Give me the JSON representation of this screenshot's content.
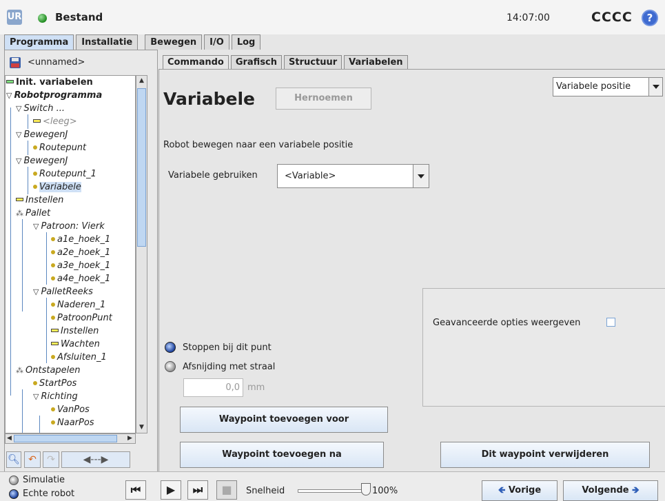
{
  "header": {
    "logo": "UR",
    "title": "Bestand",
    "time": "14:07:00",
    "robot_name": "CCCC",
    "help": "?"
  },
  "main_tabs": [
    {
      "label": "Programma",
      "active": true
    },
    {
      "label": "Installatie",
      "active": false
    },
    {
      "label": "Bewegen",
      "active": false
    },
    {
      "label": "I/O",
      "active": false
    },
    {
      "label": "Log",
      "active": false
    }
  ],
  "program": {
    "name": "<unnamed>",
    "tree": [
      "Init. variabelen",
      "Robotprogramma",
      "Switch ...",
      "<leeg>",
      "BewegenJ",
      "Routepunt",
      "BewegenJ",
      "Routepunt_1",
      "Variabele",
      "Instellen",
      "Pallet",
      "Patroon: Vierk",
      "a1e_hoek_1",
      "a2e_hoek_1",
      "a3e_hoek_1",
      "a4e_hoek_1",
      "PalletReeks",
      "Naderen_1",
      "PatroonPunt",
      "Instellen",
      "Wachten",
      "Afsluiten_1",
      "Ontstapelen",
      "StartPos",
      "Richting",
      "VanPos",
      "NaarPos"
    ],
    "selected": "Variabele"
  },
  "sub_tabs": [
    {
      "label": "Commando",
      "active": true
    },
    {
      "label": "Grafisch",
      "active": false
    },
    {
      "label": "Structuur",
      "active": false
    },
    {
      "label": "Variabelen",
      "active": false
    }
  ],
  "command": {
    "title": "Variabele",
    "rename_label": "Hernoemen",
    "type_value": "Variabele positie",
    "description": "Robot bewegen naar een variabele positie",
    "use_label": "Variabele gebruiken",
    "use_value": "<Variable>",
    "advanced_label": "Geavanceerde opties weergeven",
    "advanced_checked": false,
    "stop_label": "Stoppen bij dit punt",
    "blend_label": "Afsnijding met straal",
    "blend_value": "0,0",
    "blend_unit": "mm",
    "add_before": "Waypoint toevoegen voor",
    "add_after": "Waypoint toevoegen na",
    "remove": "Dit waypoint verwijderen"
  },
  "footer": {
    "simulation": "Simulatie",
    "real_robot": "Echte robot",
    "speed_label": "Snelheid",
    "speed_value": "100%",
    "prev": "Vorige",
    "next": "Volgende"
  },
  "colors": {
    "accent": "#cfe0f5",
    "button_top": "#f4f8fd",
    "button_bottom": "#d9e6f5",
    "help_blue": "#3f6bd0"
  }
}
